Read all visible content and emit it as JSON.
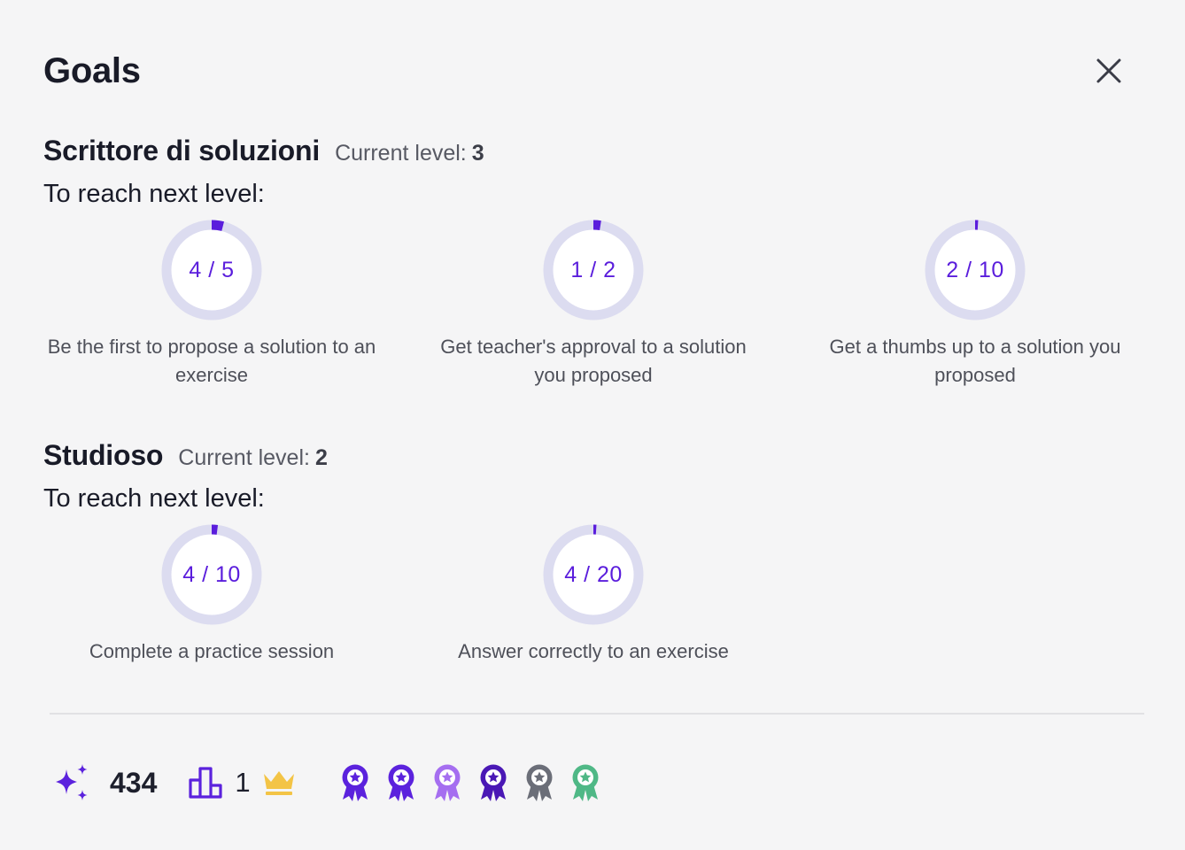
{
  "dialog": {
    "title": "Goals",
    "close_icon": "close-icon"
  },
  "sections": [
    {
      "title": "Scrittore di soluzioni",
      "level_label": "Current level:",
      "level_value": "3",
      "reach_label": "To reach next level:",
      "goals": [
        {
          "progress_text": "4 / 5",
          "current": 4,
          "target": 5,
          "description": "Be the first to propose a solution to an exercise"
        },
        {
          "progress_text": "1 / 2",
          "current": 1,
          "target": 2,
          "description": "Get teacher's approval to a solution you proposed"
        },
        {
          "progress_text": "2 / 10",
          "current": 2,
          "target": 10,
          "description": "Get a thumbs up to a solution you proposed"
        }
      ]
    },
    {
      "title": "Studioso",
      "level_label": "Current level:",
      "level_value": "2",
      "reach_label": "To reach next level:",
      "goals": [
        {
          "progress_text": "4 / 10",
          "current": 4,
          "target": 10,
          "description": "Complete a practice session"
        },
        {
          "progress_text": "4 / 20",
          "current": 4,
          "target": 20,
          "description": "Answer correctly to an exercise"
        }
      ]
    }
  ],
  "footer": {
    "points": "434",
    "points_icon": "sparkles-icon",
    "rank": "1",
    "rank_icon": "podium-icon",
    "crown_icon": "crown-icon",
    "badges": [
      {
        "icon": "award-badge-icon",
        "color": "#5b22dd"
      },
      {
        "icon": "award-badge-icon",
        "color": "#5b22dd"
      },
      {
        "icon": "award-badge-icon",
        "color": "#a56ef0"
      },
      {
        "icon": "award-badge-icon",
        "color": "#4a18b5"
      },
      {
        "icon": "award-badge-icon",
        "color": "#6b6e78"
      },
      {
        "icon": "award-badge-icon",
        "color": "#4fb886"
      }
    ]
  },
  "colors": {
    "accent": "#5a1ddc",
    "ring_track": "#dcdcf0",
    "crown": "#f3c446"
  }
}
